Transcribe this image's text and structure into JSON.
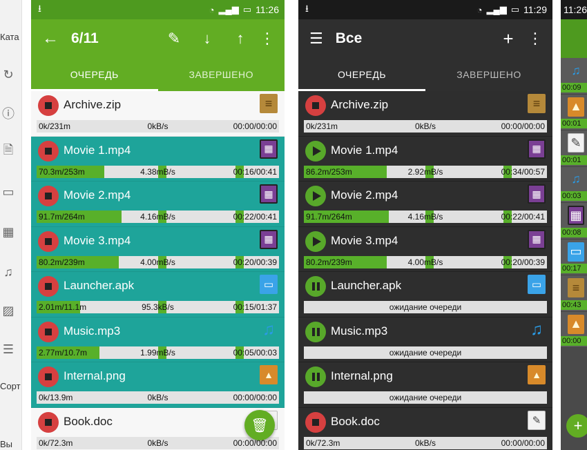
{
  "left_panel": {
    "label_top": "Ката",
    "label_sort": "Сорт",
    "label_exit": "Вы",
    "icons": [
      "sync-icon",
      "help-icon",
      "document-icon",
      "monitor-icon",
      "video-icon",
      "music-icon",
      "image-icon",
      "text-icon"
    ]
  },
  "light_phone": {
    "status_time": "11:26",
    "title": "6/11",
    "actions": [
      "edit-icon",
      "arrow-down-icon",
      "arrow-up-icon",
      "more-icon"
    ],
    "tabs": [
      "ОЧЕРЕДЬ",
      "ЗАВЕРШЕНО"
    ],
    "items": [
      {
        "name": "Archive.zip",
        "type": "zip",
        "state": "stop",
        "done": "0k/231m",
        "speed": "0kB/s",
        "time": "00:00/00:00",
        "progress": 0
      },
      {
        "name": "Movie 1.mp4",
        "type": "video",
        "state": "stop",
        "done": "70.3m/253m",
        "speed": "4.38mB/s",
        "time": "00:16/00:41",
        "progress": 0.28
      },
      {
        "name": "Movie 2.mp4",
        "type": "video",
        "state": "stop",
        "done": "91.7m/264m",
        "speed": "4.16mB/s",
        "time": "00:22/00:41",
        "progress": 0.35
      },
      {
        "name": "Movie 3.mp4",
        "type": "video",
        "state": "stop",
        "done": "80.2m/239m",
        "speed": "4.00mB/s",
        "time": "00:20/00:39",
        "progress": 0.34
      },
      {
        "name": "Launcher.apk",
        "type": "apk",
        "state": "stop",
        "done": "2.01m/11.1m",
        "speed": "95.3kB/s",
        "time": "00:15/01:37",
        "progress": 0.18
      },
      {
        "name": "Music.mp3",
        "type": "music",
        "state": "stop",
        "done": "2.77m/10.7m",
        "speed": "1.99mB/s",
        "time": "00:05/00:03",
        "progress": 0.26
      },
      {
        "name": "Internal.png",
        "type": "image",
        "state": "stop",
        "done": "0k/13.9m",
        "speed": "0kB/s",
        "time": "00:00/00:00",
        "progress": 0
      },
      {
        "name": "Book.doc",
        "type": "doc",
        "state": "stop",
        "done": "0k/72.3m",
        "speed": "0kB/s",
        "time": "00:00/00:00",
        "progress": 0
      }
    ]
  },
  "dark_phone": {
    "status_time": "11:29",
    "title": "Все",
    "actions": [
      "add-icon",
      "more-icon"
    ],
    "tabs": [
      "ОЧЕРЕДЬ",
      "ЗАВЕРШЕНО"
    ],
    "items": [
      {
        "name": "Archive.zip",
        "type": "zip",
        "state": "stop",
        "done": "0k/231m",
        "speed": "0kB/s",
        "time": "00:00/00:00",
        "progress": 0
      },
      {
        "name": "Movie 1.mp4",
        "type": "video",
        "state": "play",
        "done": "86.2m/253m",
        "speed": "2.92mB/s",
        "time": "00:34/00:57",
        "progress": 0.34
      },
      {
        "name": "Movie 2.mp4",
        "type": "video",
        "state": "play",
        "done": "91.7m/264m",
        "speed": "4.16mB/s",
        "time": "00:22/00:41",
        "progress": 0.35
      },
      {
        "name": "Movie 3.mp4",
        "type": "video",
        "state": "play",
        "done": "80.2m/239m",
        "speed": "4.00mB/s",
        "time": "00:20/00:39",
        "progress": 0.34
      },
      {
        "name": "Launcher.apk",
        "type": "apk",
        "state": "pause",
        "wait": "ожидание очереди"
      },
      {
        "name": "Music.mp3",
        "type": "music",
        "state": "pause",
        "wait": "ожидание очереди"
      },
      {
        "name": "Internal.png",
        "type": "image",
        "state": "pause",
        "wait": "ожидание очереди"
      },
      {
        "name": "Book.doc",
        "type": "doc",
        "state": "stop",
        "done": "0k/72.3m",
        "speed": "0kB/s",
        "time": "00:00/00:00",
        "progress": 0
      }
    ]
  },
  "right_panel": {
    "status_time": "11:26",
    "times": [
      "00:09",
      "00:01",
      "00:01",
      "00:03",
      "00:08",
      "00:17",
      "00:43",
      "00:00"
    ],
    "types": [
      "music",
      "image",
      "doc",
      "music",
      "video",
      "apk",
      "zip",
      "image"
    ]
  },
  "colors": {
    "green": "#62ad23",
    "teal": "#1ea49a",
    "red": "#d64040",
    "dark": "#2e2e2e"
  }
}
